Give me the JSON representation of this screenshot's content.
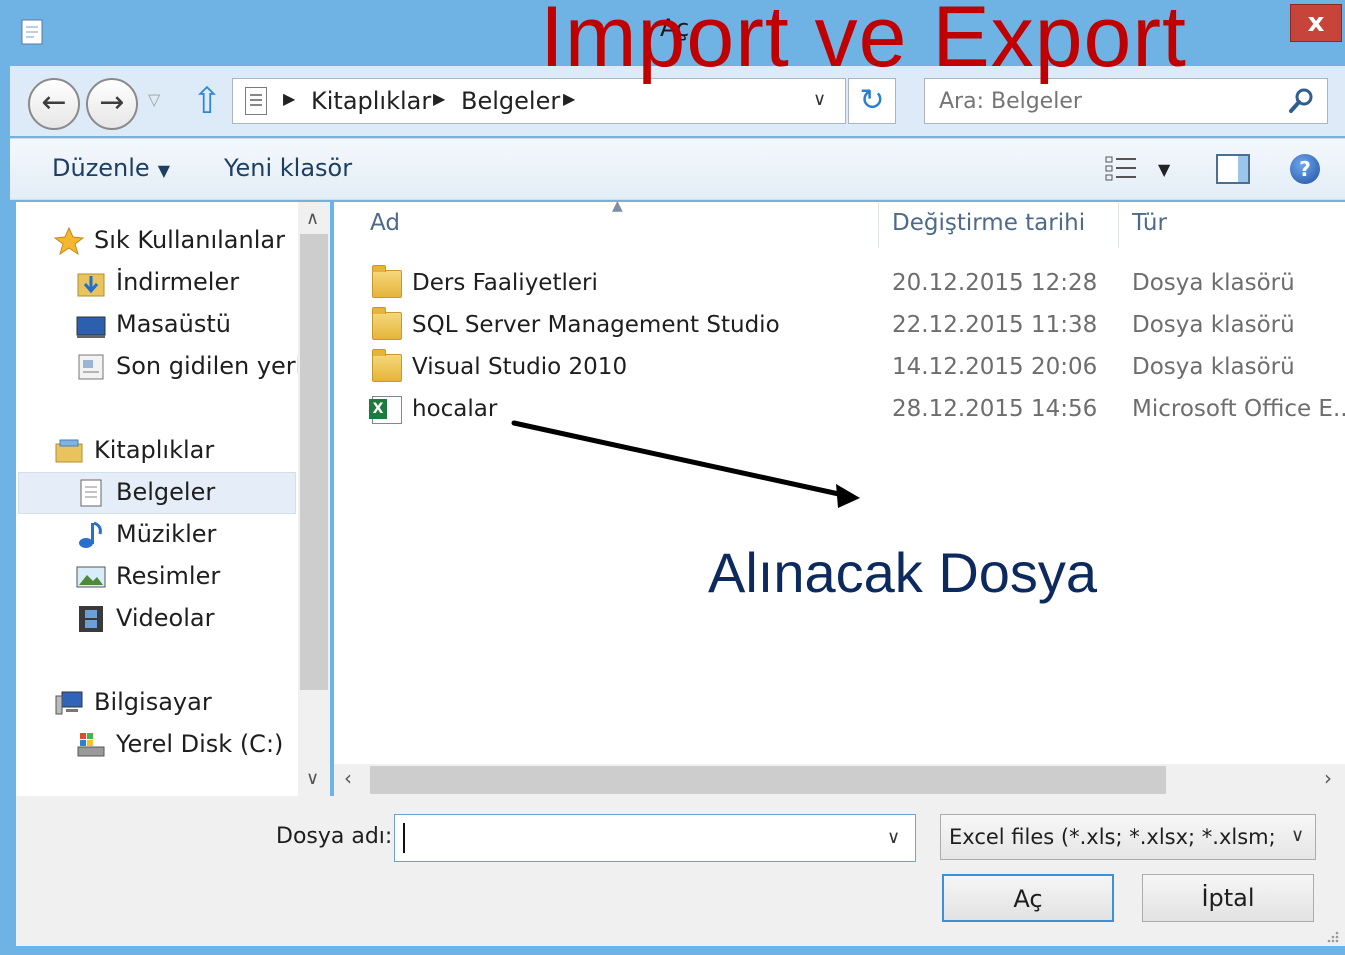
{
  "window": {
    "title": "Aç",
    "close_label": "x"
  },
  "overlay": {
    "title": "Import ve Export",
    "annotation": "Alınacak Dosya"
  },
  "nav": {
    "breadcrumbs": [
      "Kitaplıklar",
      "Belgeler"
    ],
    "search_placeholder": "Ara: Belgeler"
  },
  "toolbar": {
    "organize_label": "Düzenle",
    "new_folder_label": "Yeni klasör"
  },
  "sidebar": {
    "favorites": {
      "label": "Sık Kullanılanlar",
      "items": [
        "İndirmeler",
        "Masaüstü",
        "Son gidilen yerler"
      ]
    },
    "libraries": {
      "label": "Kitaplıklar",
      "items": [
        "Belgeler",
        "Müzikler",
        "Resimler",
        "Videolar"
      ],
      "selected": "Belgeler"
    },
    "computer": {
      "label": "Bilgisayar",
      "items": [
        "Yerel Disk (C:)"
      ]
    }
  },
  "filelist": {
    "columns": [
      "Ad",
      "Değiştirme tarihi",
      "Tür"
    ],
    "rows": [
      {
        "name": "Ders Faaliyetleri",
        "date": "20.12.2015 12:28",
        "type": "Dosya klasörü",
        "icon": "folder-icon"
      },
      {
        "name": "SQL Server Management Studio",
        "date": "22.12.2015 11:38",
        "type": "Dosya klasörü",
        "icon": "folder-icon"
      },
      {
        "name": "Visual Studio 2010",
        "date": "14.12.2015 20:06",
        "type": "Dosya klasörü",
        "icon": "folder-icon"
      },
      {
        "name": "hocalar",
        "date": "28.12.2015 14:56",
        "type": "Microsoft Office E...",
        "icon": "excel-file-icon"
      }
    ]
  },
  "footer": {
    "filename_label": "Dosya adı:",
    "filename_value": "",
    "filter_value": "Excel files (*.xls; *.xlsx; *.xlsm; *.x",
    "open_label": "Aç",
    "cancel_label": "İptal"
  },
  "colors": {
    "frame": "#6fb3e4",
    "overlay_title": "#c00000",
    "annotation": "#0d2a5e",
    "close_button": "#c7443a"
  }
}
